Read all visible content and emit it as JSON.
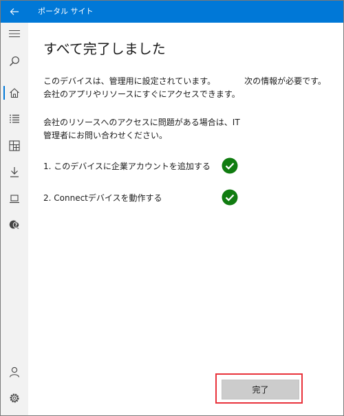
{
  "window": {
    "title": "ポータル サイト",
    "accent_color": "#0078d7"
  },
  "titlebar": {
    "back_icon": "arrow-left-icon"
  },
  "sidebar": {
    "items": [
      {
        "name": "menu",
        "icon": "hamburger-icon",
        "selected": false
      },
      {
        "name": "search",
        "icon": "search-icon",
        "selected": false
      },
      {
        "name": "home",
        "icon": "home-icon",
        "selected": true
      },
      {
        "name": "apps",
        "icon": "list-icon",
        "selected": false
      },
      {
        "name": "categories",
        "icon": "grid-icon",
        "selected": false
      },
      {
        "name": "downloads",
        "icon": "download-icon",
        "selected": false
      },
      {
        "name": "devices",
        "icon": "laptop-icon",
        "selected": false
      },
      {
        "name": "support",
        "icon": "help-chat-icon",
        "selected": false
      }
    ],
    "footer": [
      {
        "name": "account",
        "icon": "person-icon"
      },
      {
        "name": "settings",
        "icon": "gear-icon"
      }
    ]
  },
  "main": {
    "title": "すべて完了しました",
    "paragraph1": [
      "このデバイスは、管理用に設定されています。　　　　次の情報が必要です。",
      "会社のアプリやリソースにすぐにアクセスできます。"
    ],
    "paragraph2": [
      "会社のリソースへのアクセスに問題がある場合は、IT",
      "管理者にお問い合わせください。"
    ],
    "steps": [
      {
        "label": "1. このデバイスに企業アカウントを追加する",
        "status": "complete",
        "status_icon": "check-circle-icon",
        "status_color": "#107c10"
      },
      {
        "label": "2. Connectデバイスを動作する",
        "status": "complete",
        "status_icon": "check-circle-icon",
        "status_color": "#107c10"
      }
    ],
    "done_button": "完了",
    "highlight_color": "#e8313a"
  }
}
